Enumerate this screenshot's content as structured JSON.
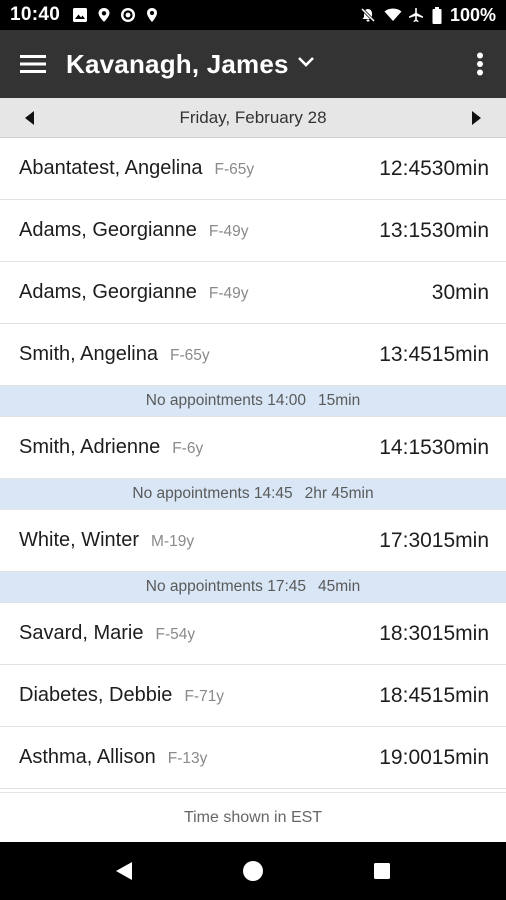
{
  "status_bar": {
    "time": "10:40",
    "battery": "100%",
    "left_icons": [
      "gallery-icon",
      "location-pin-icon",
      "target-icon",
      "map-marker-icon"
    ],
    "right_icons": [
      "mute-icon",
      "wifi-icon",
      "airplane-icon",
      "battery-icon"
    ]
  },
  "app_bar": {
    "title": "Kavanagh, James",
    "menu_icon": "hamburger-menu-icon",
    "dropdown_icon": "chevron-down-icon",
    "overflow_icon": "more-vert-icon"
  },
  "date_bar": {
    "date": "Friday, February 28",
    "prev_icon": "arrow-left-icon",
    "next_icon": "arrow-right-icon"
  },
  "appointments": [
    {
      "name": "Abantatest, Angelina",
      "meta": "F-65y",
      "time": "12:4530min"
    },
    {
      "name": "Adams, Georgianne",
      "meta": "F-49y",
      "time": "13:1530min"
    },
    {
      "name": "Adams, Georgianne",
      "meta": "F-49y",
      "time": "30min"
    },
    {
      "name": "Smith, Angelina",
      "meta": "F-65y",
      "time": "13:4515min"
    },
    {
      "gap": true,
      "label": "No appointments 14:00",
      "duration": "15min"
    },
    {
      "name": "Smith, Adrienne",
      "meta": "F-6y",
      "time": "14:1530min"
    },
    {
      "gap": true,
      "label": "No appointments 14:45",
      "duration": "2hr 45min"
    },
    {
      "name": "White, Winter",
      "meta": "M-19y",
      "time": "17:3015min"
    },
    {
      "gap": true,
      "label": "No appointments 17:45",
      "duration": "45min"
    },
    {
      "name": "Savard, Marie",
      "meta": "F-54y",
      "time": "18:3015min"
    },
    {
      "name": "Diabetes, Debbie",
      "meta": "F-71y",
      "time": "18:4515min"
    },
    {
      "name": "Asthma, Allison",
      "meta": "F-13y",
      "time": "19:0015min"
    }
  ],
  "footer": {
    "note": "Time shown in EST"
  },
  "nav_bar": {
    "icons": [
      "back-icon",
      "home-icon",
      "recents-icon"
    ]
  },
  "colors": {
    "app_bar": "#333333",
    "status_bar": "#000000",
    "gap_row": "#d8e6f6",
    "date_bar": "#e6e6e6"
  }
}
